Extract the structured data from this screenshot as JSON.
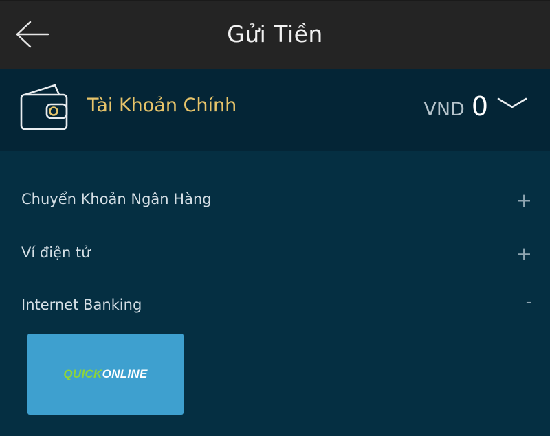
{
  "header": {
    "title": "Gửi Tiền"
  },
  "account": {
    "name": "Tài Khoản Chính",
    "currency": "VND",
    "balance": "0"
  },
  "methods": [
    {
      "label": "Chuyển Khoản Ngân Hàng",
      "toggle": "+"
    },
    {
      "label": "Ví điện tử",
      "toggle": "+"
    },
    {
      "label": "Internet Banking",
      "toggle": "-"
    }
  ],
  "internet_banking": {
    "options": [
      {
        "name_part1": "QUICK",
        "name_part2": "ONLINE"
      }
    ]
  },
  "colors": {
    "header_bg": "#242424",
    "account_bg": "#042536",
    "page_bg": "#052f42",
    "accent_gold": "#e7c46a",
    "tile_bg": "#3ea0cf",
    "logo_green": "#8ed43a"
  },
  "icons": {
    "back": "arrow-left-icon",
    "wallet": "wallet-icon",
    "expand": "chevron-down-icon"
  }
}
